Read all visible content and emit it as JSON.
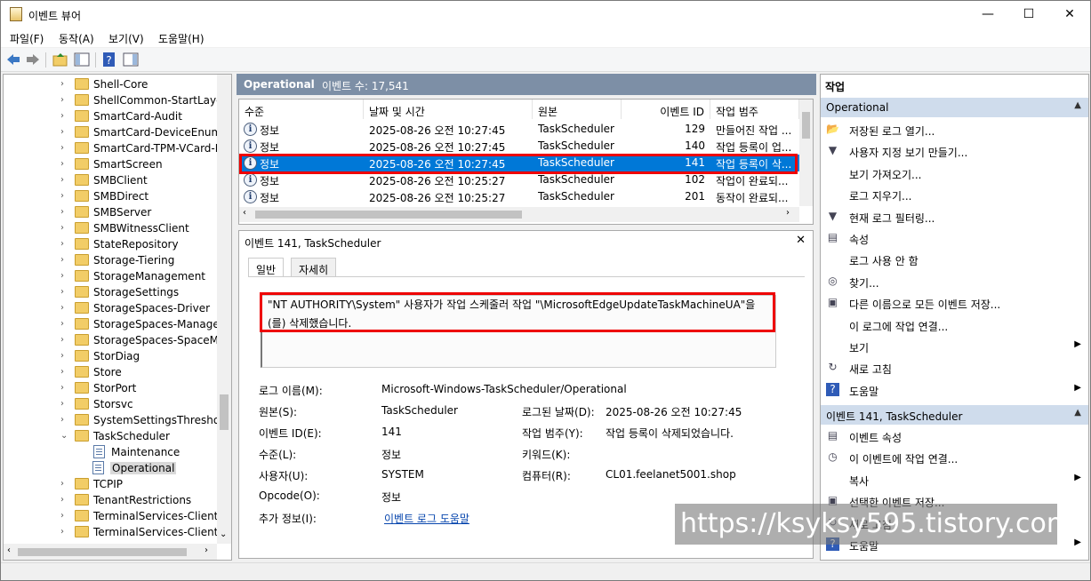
{
  "window": {
    "title": "이벤트 뷰어",
    "minimize": "—",
    "maximize": "☐",
    "close": "✕"
  },
  "menu": [
    "파일(F)",
    "동작(A)",
    "보기(V)",
    "도움말(H)"
  ],
  "tree": {
    "items": [
      "Shell-Core",
      "ShellCommon-StartLayou",
      "SmartCard-Audit",
      "SmartCard-DeviceEnum",
      "SmartCard-TPM-VCard-M",
      "SmartScreen",
      "SMBClient",
      "SMBDirect",
      "SMBServer",
      "SMBWitnessClient",
      "StateRepository",
      "Storage-Tiering",
      "StorageManagement",
      "StorageSettings",
      "StorageSpaces-Driver",
      "StorageSpaces-Manageme",
      "StorageSpaces-SpaceMan",
      "StorDiag",
      "Store",
      "StorPort",
      "Storsvc",
      "SystemSettingsThreshold",
      "TaskScheduler"
    ],
    "children": [
      "Maintenance",
      "Operational"
    ],
    "after": [
      "TCPIP",
      "TenantRestrictions",
      "TerminalServices-ClientAc",
      "TerminalServices-ClientUS"
    ]
  },
  "middle": {
    "title": "Operational",
    "count_label": "이벤트 수: 17,541",
    "columns": [
      "수준",
      "날짜 및 시간",
      "원본",
      "이벤트 ID",
      "작업 범주"
    ],
    "rows": [
      {
        "level": "정보",
        "date": "2025-08-26 오전 10:27:45",
        "source": "TaskScheduler",
        "id": "129",
        "cat": "만들어진 작업 ..."
      },
      {
        "level": "정보",
        "date": "2025-08-26 오전 10:27:45",
        "source": "TaskScheduler",
        "id": "140",
        "cat": "작업 등록이 업..."
      },
      {
        "level": "정보",
        "date": "2025-08-26 오전 10:27:45",
        "source": "TaskScheduler",
        "id": "141",
        "cat": "작업 등록이 삭..."
      },
      {
        "level": "정보",
        "date": "2025-08-26 오전 10:25:27",
        "source": "TaskScheduler",
        "id": "102",
        "cat": "작업이 완료되..."
      },
      {
        "level": "정보",
        "date": "2025-08-26 오전 10:25:27",
        "source": "TaskScheduler",
        "id": "201",
        "cat": "동작이 완료되..."
      }
    ],
    "selected_row": 2
  },
  "detail": {
    "title": "이벤트 141, TaskScheduler",
    "tabs": [
      "일반",
      "자세히"
    ],
    "message": "\"NT AUTHORITY\\System\" 사용자가 작업 스케줄러 작업 \"\\MicrosoftEdgeUpdateTaskMachineUA\"을(를) 삭제했습니다.",
    "fields": {
      "log_name_l": "로그 이름(M):",
      "log_name": "Microsoft-Windows-TaskScheduler/Operational",
      "source_l": "원본(S):",
      "source": "TaskScheduler",
      "logged_l": "로그된 날짜(D):",
      "logged": "2025-08-26 오전 10:27:45",
      "eid_l": "이벤트 ID(E):",
      "eid": "141",
      "cat_l": "작업 범주(Y):",
      "cat": "작업 등록이 삭제되었습니다.",
      "level_l": "수준(L):",
      "level": "정보",
      "kw_l": "키워드(K):",
      "kw": "",
      "user_l": "사용자(U):",
      "user": "SYSTEM",
      "comp_l": "컴퓨터(R):",
      "comp": "CL01.feelanet5001.shop",
      "op_l": "Opcode(O):",
      "op": "정보",
      "more_l": "추가 정보(I):",
      "more": "이벤트 로그 도움말"
    }
  },
  "actions": {
    "title": "작업",
    "sec1": "Operational",
    "items1": [
      "저장된 로그 열기...",
      "사용자 지정 보기 만들기...",
      "보기 가져오기...",
      "로그 지우기...",
      "현재 로그 필터링...",
      "속성",
      "로그 사용 안 함",
      "찾기...",
      "다른 이름으로 모든 이벤트 저장...",
      "이 로그에 작업 연결...",
      "보기",
      "새로 고침",
      "도움말"
    ],
    "sec2": "이벤트 141, TaskScheduler",
    "items2": [
      "이벤트 속성",
      "이 이벤트에 작업 연결...",
      "복사",
      "선택한 이벤트 저장...",
      "새로 고침",
      "도움말"
    ]
  },
  "watermark": "https://ksyksy595.tistory.com"
}
